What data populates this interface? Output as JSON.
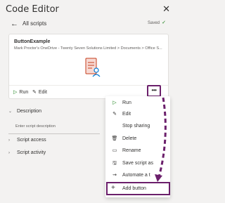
{
  "panel": {
    "title": "Code Editor",
    "close_glyph": "✕"
  },
  "nav": {
    "back_glyph": "←",
    "title": "All scripts",
    "status": "Saved",
    "status_glyph": "✓"
  },
  "script_card": {
    "name": "ButtonExample",
    "path": "Mark Proctor's OneDrive - Twenty Seven Solutions Limited > Documents > Office S...",
    "run_label": "Run",
    "edit_label": "Edit",
    "more_glyph": "•••"
  },
  "sections": {
    "description_label": "Description",
    "description_placeholder": "Enter script description",
    "access_label": "Script access",
    "activity_label": "Script activity"
  },
  "menu": {
    "items": [
      {
        "label": "Run",
        "icon": "play-icon",
        "glyph": "▷"
      },
      {
        "label": "Edit",
        "icon": "edit-icon",
        "glyph": "✎"
      },
      {
        "label": "Stop sharing",
        "icon": "",
        "glyph": ""
      },
      {
        "label": "Delete",
        "icon": "delete-icon",
        "glyph": "🗑"
      },
      {
        "label": "Rename",
        "icon": "rename-icon",
        "glyph": "▭"
      },
      {
        "label": "Save script as",
        "icon": "save-as-icon",
        "glyph": "🖫"
      },
      {
        "label": "Automate a t",
        "icon": "automate-icon",
        "glyph": "⇝"
      }
    ],
    "add_button": {
      "label": "Add button",
      "icon": "plus-icon",
      "glyph": "+"
    }
  },
  "colors": {
    "highlight": "#6b1f6b",
    "run_green": "#107c10"
  }
}
